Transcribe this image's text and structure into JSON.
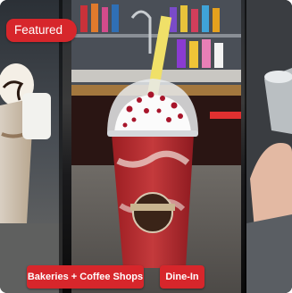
{
  "card": {
    "featured_label": "Featured",
    "tags": [
      {
        "label": "Bakeries + Coffee Shops"
      },
      {
        "label": "Dine-In"
      }
    ]
  },
  "photos": [
    {
      "subject": "dessert cup with chocolate drizzle and whipped cream"
    },
    {
      "subject": "strawberry milkshake with whipped cream and yellow straw"
    },
    {
      "subject": "hand holding a clear cup"
    }
  ],
  "colors": {
    "accent": "#d7262b",
    "chip_text": "#ffffff"
  }
}
